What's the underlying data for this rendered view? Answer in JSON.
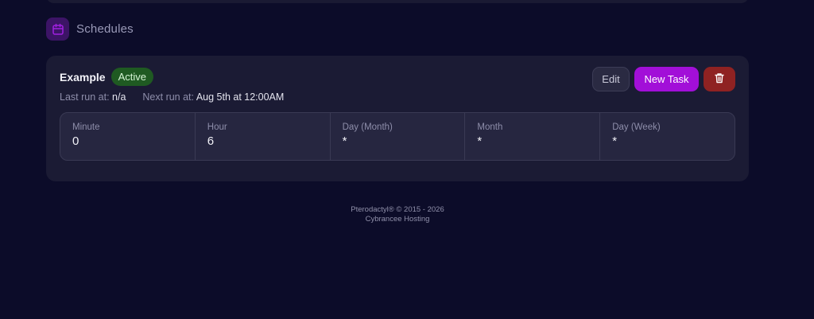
{
  "section": {
    "title": "Schedules",
    "icon": "calendar-icon"
  },
  "schedule": {
    "name": "Example",
    "status": "Active",
    "last_run_label": "Last run at:",
    "last_run_value": "n/a",
    "next_run_label": "Next run at:",
    "next_run_value": "Aug 5th at 12:00AM",
    "actions": {
      "edit_label": "Edit",
      "new_task_label": "New Task",
      "delete_icon": "trash-icon"
    },
    "cron": [
      {
        "label": "Minute",
        "value": "0"
      },
      {
        "label": "Hour",
        "value": "6"
      },
      {
        "label": "Day (Month)",
        "value": "*"
      },
      {
        "label": "Month",
        "value": "*"
      },
      {
        "label": "Day (Week)",
        "value": "*"
      }
    ]
  },
  "footer": {
    "copyright": "Pterodactyl® © 2015 - 2026",
    "host": "Cybrancee Hosting"
  },
  "colors": {
    "background": "#0c0c29",
    "card": "#1b1b34",
    "accent": "#a20fd8",
    "active_badge": "#1f5a22",
    "danger": "#8f2222"
  }
}
